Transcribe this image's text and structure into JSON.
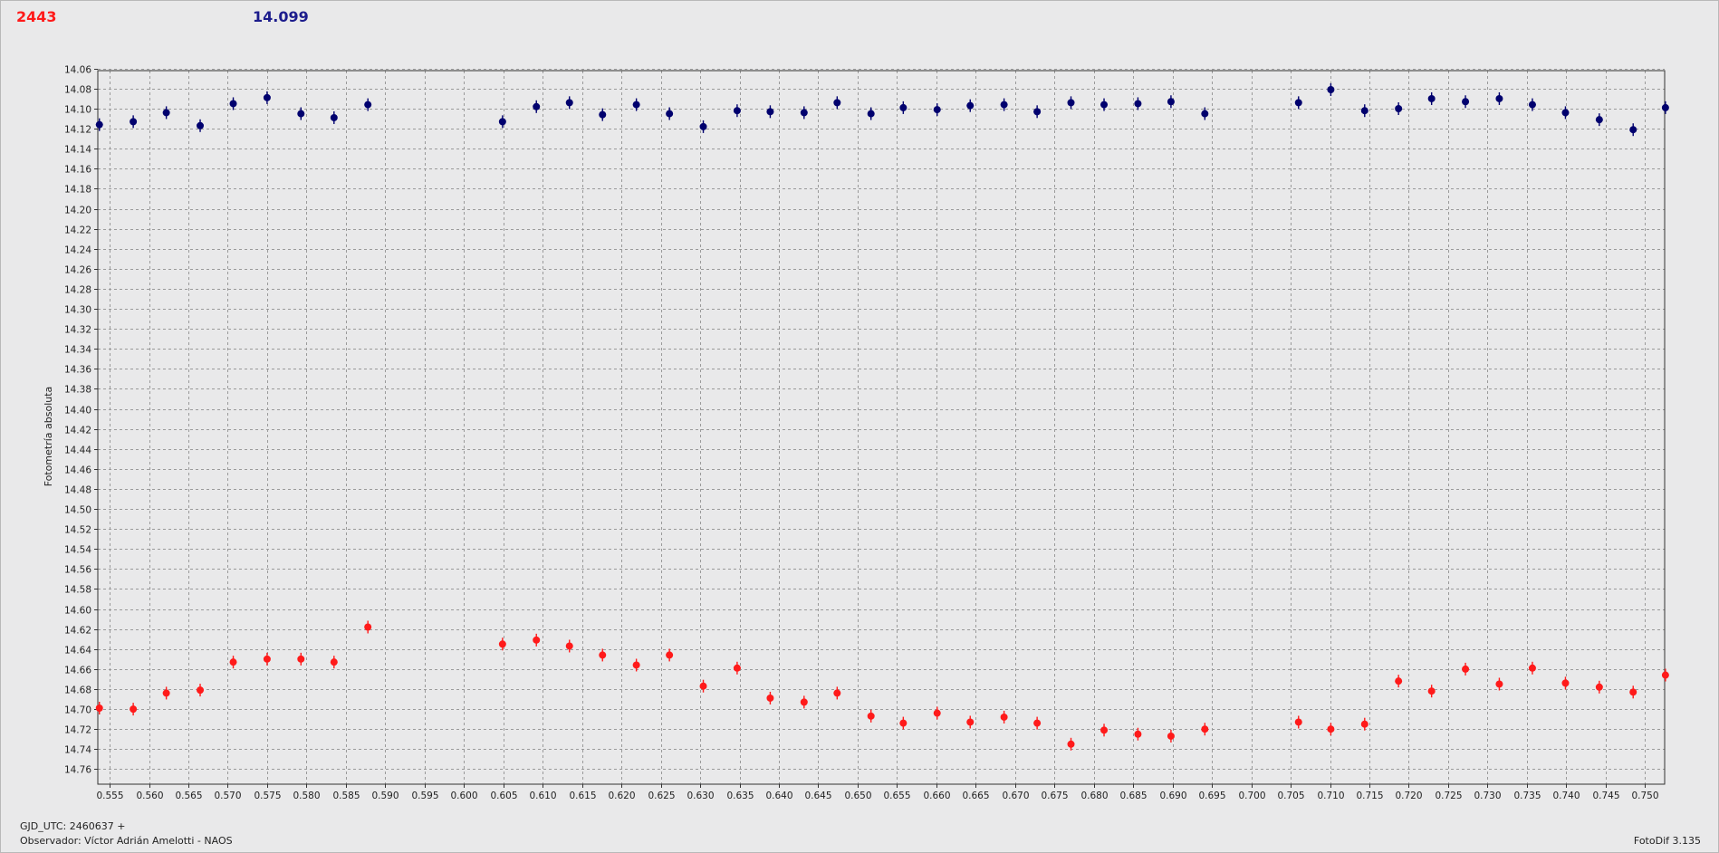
{
  "header": {
    "object_value": "2443",
    "comparison_value": "14.099"
  },
  "footer": {
    "gjd": "GJD_UTC: 2460637 +",
    "observer": "Observador: Víctor Adrián Amelotti - NAOS",
    "version": "FotoDif 3.135"
  },
  "colors": {
    "object": "#ff1a1a",
    "comparison": "#00006e",
    "grid": "#9a9a9a",
    "plot_bg": "#e9e9ea"
  },
  "chart_data": {
    "type": "scatter",
    "ylabel": "Fotometría absoluta",
    "xlabel": "",
    "xlim": [
      0.5535,
      0.7525
    ],
    "ylim": [
      14.775,
      14.062
    ],
    "y_inverted": true,
    "grid": true,
    "x_ticks": [
      "0.555",
      "0.560",
      "0.565",
      "0.570",
      "0.575",
      "0.580",
      "0.585",
      "0.590",
      "0.595",
      "0.600",
      "0.605",
      "0.610",
      "0.615",
      "0.620",
      "0.625",
      "0.630",
      "0.635",
      "0.640",
      "0.645",
      "0.650",
      "0.655",
      "0.660",
      "0.665",
      "0.670",
      "0.675",
      "0.680",
      "0.685",
      "0.690",
      "0.695",
      "0.700",
      "0.705",
      "0.710",
      "0.715",
      "0.720",
      "0.725",
      "0.730",
      "0.735",
      "0.740",
      "0.745",
      "0.750"
    ],
    "y_ticks": [
      "14.06",
      "14.08",
      "14.10",
      "14.12",
      "14.14",
      "14.16",
      "14.18",
      "14.20",
      "14.22",
      "14.24",
      "14.26",
      "14.28",
      "14.30",
      "14.32",
      "14.34",
      "14.36",
      "14.38",
      "14.40",
      "14.42",
      "14.44",
      "14.46",
      "14.48",
      "14.50",
      "14.52",
      "14.54",
      "14.56",
      "14.58",
      "14.60",
      "14.62",
      "14.64",
      "14.66",
      "14.68",
      "14.70",
      "14.72",
      "14.74",
      "14.76"
    ],
    "series": [
      {
        "color": "#00006e",
        "x": [
          0.5537,
          0.558,
          0.5622,
          0.5665,
          0.5707,
          0.575,
          0.5793,
          0.5835,
          0.5878,
          0.6049,
          0.6092,
          0.6134,
          0.6176,
          0.6219,
          0.6261,
          0.6304,
          0.6347,
          0.6389,
          0.6432,
          0.6474,
          0.6517,
          0.6558,
          0.6601,
          0.6643,
          0.6686,
          0.6728,
          0.6771,
          0.6813,
          0.6856,
          0.6898,
          0.6941,
          0.706,
          0.7101,
          0.7144,
          0.7187,
          0.7229,
          0.7272,
          0.7315,
          0.7357,
          0.7399,
          0.7442,
          0.7485,
          0.7526
        ],
        "y": [
          14.116,
          14.113,
          14.104,
          14.117,
          14.095,
          14.089,
          14.105,
          14.109,
          14.096,
          14.113,
          14.098,
          14.094,
          14.106,
          14.096,
          14.105,
          14.118,
          14.102,
          14.103,
          14.104,
          14.094,
          14.105,
          14.099,
          14.101,
          14.097,
          14.096,
          14.103,
          14.094,
          14.096,
          14.095,
          14.093,
          14.105,
          14.094,
          14.081,
          14.102,
          14.1,
          14.09,
          14.093,
          14.09,
          14.096,
          14.104,
          14.111,
          14.121,
          14.099
        ]
      },
      {
        "color": "#ff1a1a",
        "x": [
          0.5537,
          0.558,
          0.5622,
          0.5665,
          0.5707,
          0.575,
          0.5793,
          0.5835,
          0.5878,
          0.6049,
          0.6092,
          0.6134,
          0.6176,
          0.6219,
          0.6261,
          0.6304,
          0.6347,
          0.6389,
          0.6432,
          0.6474,
          0.6517,
          0.6558,
          0.6601,
          0.6643,
          0.6686,
          0.6728,
          0.6771,
          0.6813,
          0.6856,
          0.6898,
          0.6941,
          0.706,
          0.7101,
          0.7144,
          0.7187,
          0.7229,
          0.7272,
          0.7315,
          0.7357,
          0.7399,
          0.7442,
          0.7485,
          0.7526
        ],
        "y": [
          14.699,
          14.7,
          14.684,
          14.681,
          14.653,
          14.65,
          14.65,
          14.653,
          14.618,
          14.635,
          14.631,
          14.637,
          14.646,
          14.656,
          14.646,
          14.677,
          14.659,
          14.689,
          14.693,
          14.684,
          14.707,
          14.714,
          14.704,
          14.713,
          14.708,
          14.714,
          14.735,
          14.721,
          14.725,
          14.727,
          14.72,
          14.713,
          14.72,
          14.715,
          14.672,
          14.682,
          14.66,
          14.675,
          14.659,
          14.674,
          14.678,
          14.683,
          14.666
        ]
      }
    ]
  }
}
